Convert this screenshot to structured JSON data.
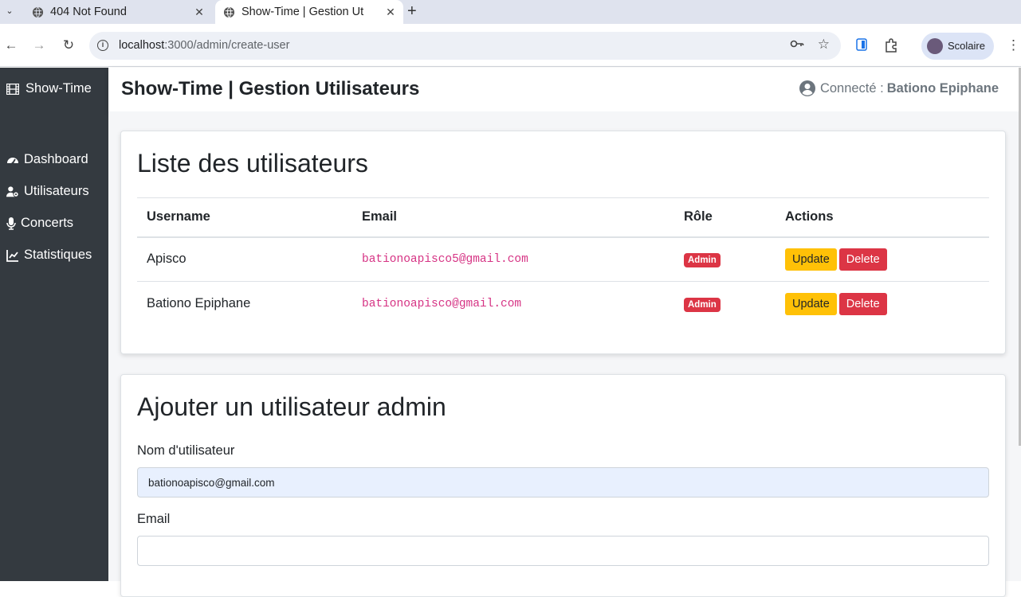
{
  "browser": {
    "tabs": [
      {
        "title": "404 Not Found",
        "active": false
      },
      {
        "title": "Show-Time | Gestion Ut",
        "active": true
      }
    ],
    "url_host": "localhost",
    "url_rest": ":3000/admin/create-user",
    "profile_name": "Scolaire"
  },
  "sidebar": {
    "brand": "Show-Time",
    "items": [
      {
        "label": "Dashboard",
        "icon": "gauge-icon"
      },
      {
        "label": "Utilisateurs",
        "icon": "user-gear-icon"
      },
      {
        "label": "Concerts",
        "icon": "microphone-icon"
      },
      {
        "label": "Statistiques",
        "icon": "line-chart-icon"
      }
    ]
  },
  "header": {
    "title": "Show-Time | Gestion Utilisateurs",
    "connected_label": "Connecté :",
    "connected_user": "Bationo Epiphane"
  },
  "users_card": {
    "title": "Liste des utilisateurs",
    "columns": [
      "Username",
      "Email",
      "Rôle",
      "Actions"
    ],
    "rows": [
      {
        "username": "Apisco",
        "email": "bationoapisco5@gmail.com",
        "role": "Admin"
      },
      {
        "username": "Bationo Epiphane",
        "email": "bationoapisco@gmail.com",
        "role": "Admin"
      }
    ],
    "update_label": "Update",
    "delete_label": "Delete"
  },
  "form_card": {
    "title": "Ajouter un utilisateur admin",
    "username_label": "Nom d'utilisateur",
    "username_value": "bationoapisco@gmail.com",
    "email_label": "Email",
    "email_value": ""
  },
  "colors": {
    "sidebar_bg": "#343a40",
    "badge_admin": "#dc3545",
    "update_btn": "#ffc107",
    "delete_btn": "#dc3545",
    "email_text": "#d63384"
  }
}
